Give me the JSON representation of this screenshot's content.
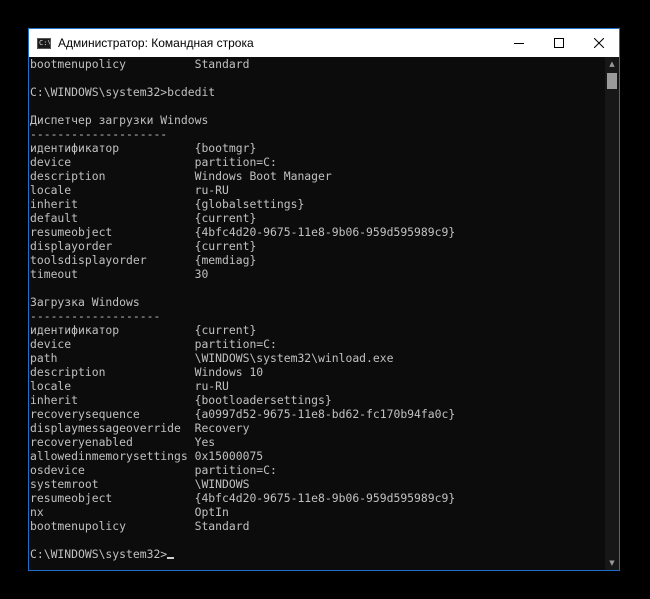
{
  "window": {
    "title": "Администратор: Командная строка",
    "icon": "cmd-icon",
    "icon_text": "C:\\"
  },
  "controls": {
    "minimize": "minimize-icon",
    "maximize": "maximize-icon",
    "close": "close-icon"
  },
  "console": {
    "lines": [
      "bootmenupolicy          Standard",
      "",
      "C:\\WINDOWS\\system32>bcdedit",
      "",
      "Диспетчер загрузки Windows",
      "--------------------",
      "идентификатор           {bootmgr}",
      "device                  partition=C:",
      "description             Windows Boot Manager",
      "locale                  ru-RU",
      "inherit                 {globalsettings}",
      "default                 {current}",
      "resumeobject            {4bfc4d20-9675-11e8-9b06-959d595989c9}",
      "displayorder            {current}",
      "toolsdisplayorder       {memdiag}",
      "timeout                 30",
      "",
      "Загрузка Windows",
      "-------------------",
      "идентификатор           {current}",
      "device                  partition=C:",
      "path                    \\WINDOWS\\system32\\winload.exe",
      "description             Windows 10",
      "locale                  ru-RU",
      "inherit                 {bootloadersettings}",
      "recoverysequence        {a0997d52-9675-11e8-bd62-fc170b94fa0c}",
      "displaymessageoverride  Recovery",
      "recoveryenabled         Yes",
      "allowedinmemorysettings 0x15000075",
      "osdevice                partition=C:",
      "systemroot              \\WINDOWS",
      "resumeobject            {4bfc4d20-9675-11e8-9b06-959d595989c9}",
      "nx                      OptIn",
      "bootmenupolicy          Standard",
      ""
    ],
    "prompt": "C:\\WINDOWS\\system32>"
  }
}
